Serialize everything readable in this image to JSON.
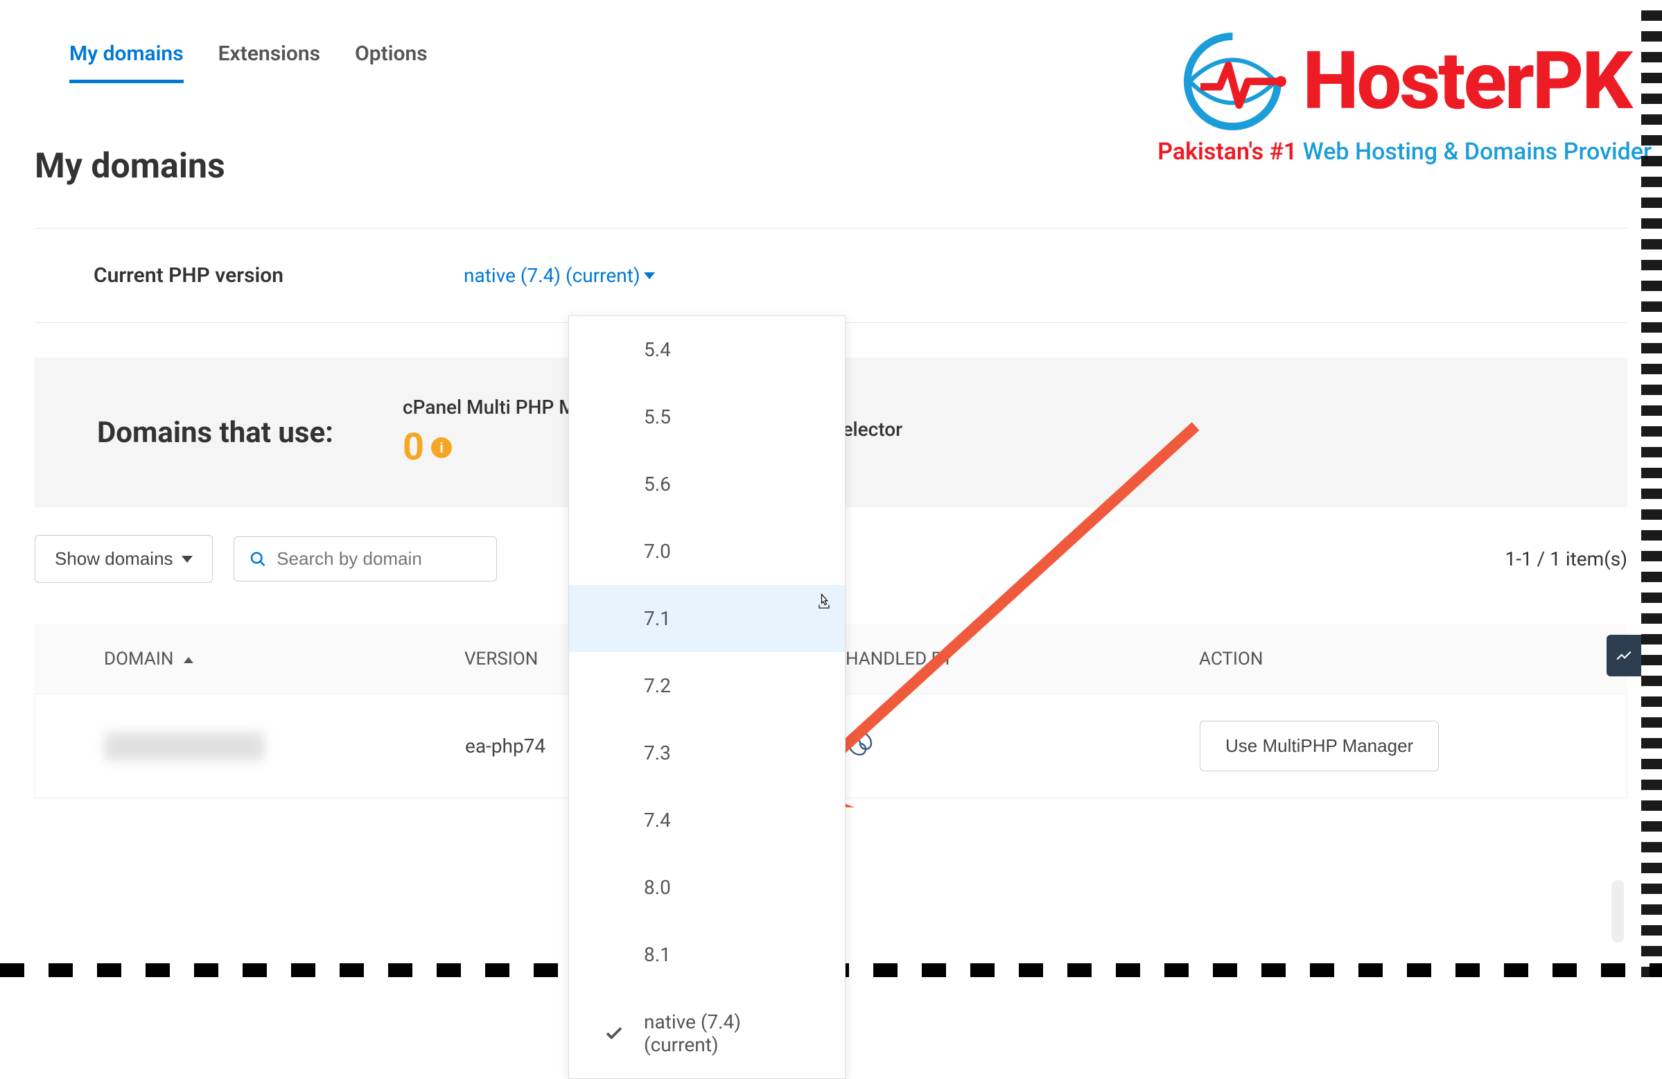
{
  "tabs": {
    "my_domains": "My domains",
    "extensions": "Extensions",
    "options": "Options"
  },
  "page_title": "My domains",
  "php_version": {
    "label": "Current PHP version",
    "current": "native (7.4) (current)",
    "options": [
      "5.4",
      "5.5",
      "5.6",
      "7.0",
      "7.1",
      "7.2",
      "7.3",
      "7.4",
      "8.0",
      "8.1",
      "native (7.4) (current)"
    ]
  },
  "domains_use": {
    "label": "Domains that use:",
    "multi_php_label": "cPanel Multi PHP Manager",
    "multi_php_count": "0",
    "selector_label": "PHP Selector"
  },
  "toolbar": {
    "show_domains": "Show domains",
    "search_placeholder": "Search by domain",
    "item_count": "1-1 / 1 item(s)"
  },
  "table": {
    "headers": {
      "domain": "DOMAIN",
      "version": "VERSION",
      "handled": "HANDLED BY",
      "action": "ACTION"
    },
    "rows": [
      {
        "domain": "",
        "version": "ea-php74",
        "handled": "spinner",
        "action_label": "Use MultiPHP Manager"
      }
    ]
  },
  "logo": {
    "brand_text": "HosterPK",
    "tagline_red": "Pakistan's #1",
    "tagline_blue": "Web Hosting & Domains Provider"
  }
}
